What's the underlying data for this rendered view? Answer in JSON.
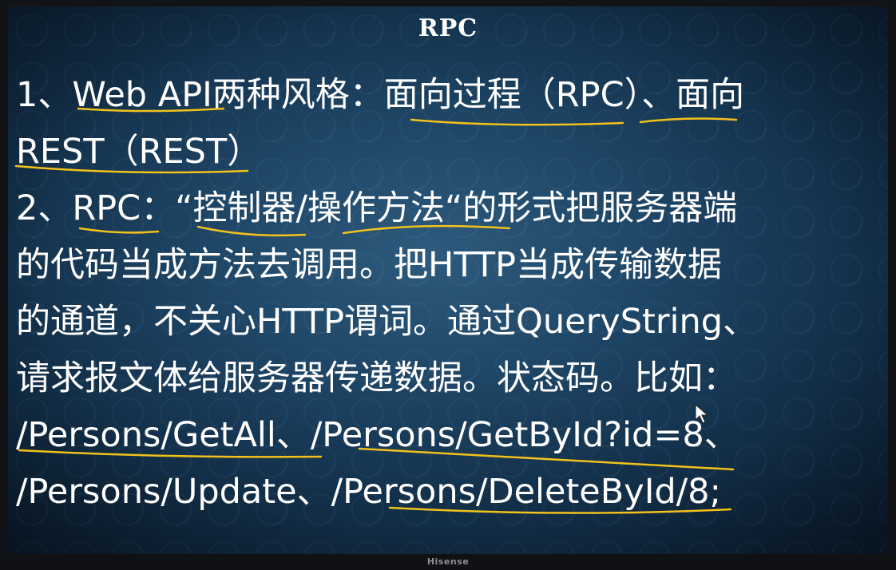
{
  "slide": {
    "title": "RPC",
    "lines": [
      "1、Web API两种风格：面向过程（RPC）、面向",
      "REST（REST）",
      "2、RPC：“控制器/操作方法“的形式把服务器端",
      "的代码当成方法去调用。把HTTP当成传输数据",
      "的通道，不关心HTTP谓词。通过QueryString、",
      "请求报文体给服务器传递数据。状态码。比如：",
      "/Persons/GetAll、/Persons/GetById?id=8、",
      "/Persons/Update、/Persons/DeleteById/8;"
    ]
  },
  "tv": {
    "brand": "Hisense"
  },
  "colors": {
    "background": "#1e4565",
    "text": "#ffffff",
    "annotation": "#f2c21a"
  },
  "icons": {
    "cursor": "mouse-pointer-icon"
  }
}
